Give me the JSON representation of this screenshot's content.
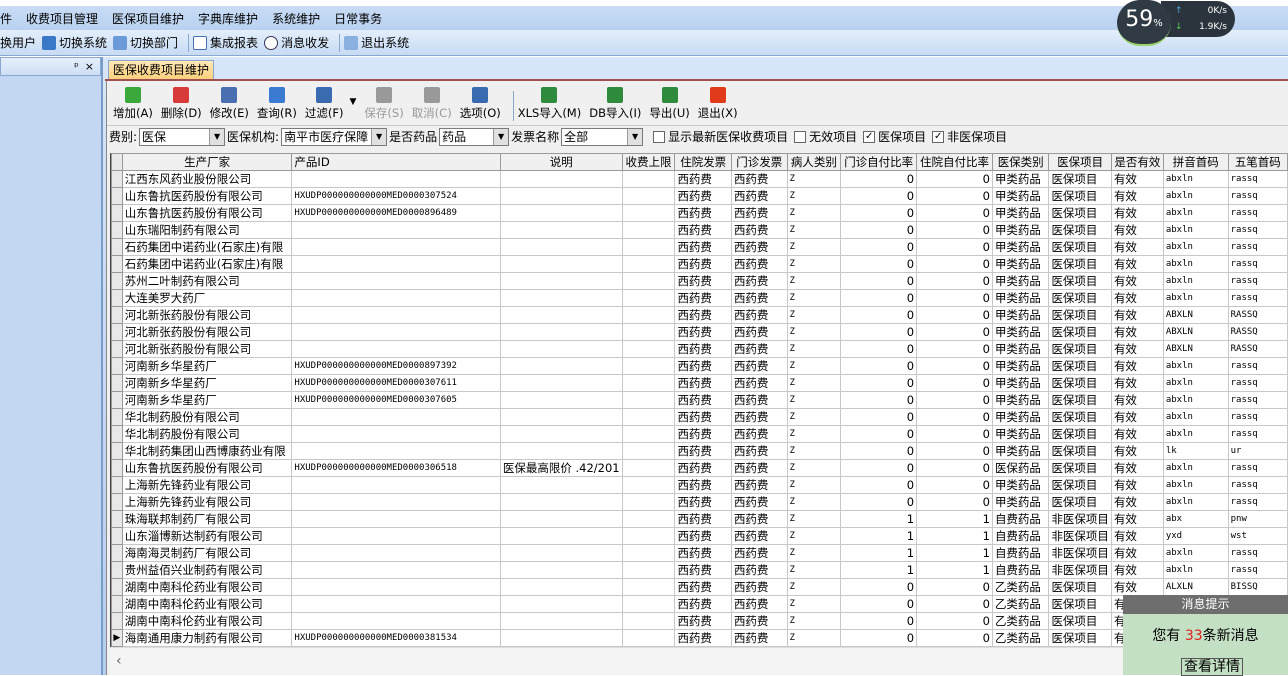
{
  "menu": [
    "收费项目管理",
    "医保项目维护",
    "字典库维护",
    "系统维护",
    "日常事务"
  ],
  "menu_prefix": "件",
  "toolbar": {
    "items": [
      "换用户",
      "切换系统",
      "切换部门",
      "集成报表",
      "消息收发",
      "退出系统"
    ]
  },
  "left_pane": {
    "pin": "ᵖ",
    "close": "×"
  },
  "tab": "医保收费项目维护",
  "actions": [
    {
      "label": "增加(A)",
      "color": "#3aa83a"
    },
    {
      "label": "删除(D)",
      "color": "#d83a3a"
    },
    {
      "label": "修改(E)",
      "color": "#4a6fb0"
    },
    {
      "label": "查询(R)",
      "color": "#3a7ad0"
    },
    {
      "label": "过滤(F)",
      "color": "#3a6ab0"
    },
    {
      "label": "保存(S)",
      "color": "#999999",
      "disabled": true
    },
    {
      "label": "取消(C)",
      "color": "#999999",
      "disabled": true
    },
    {
      "label": "选项(O)",
      "color": "#3a6ab0"
    },
    {
      "label": "XLS导入(M)",
      "color": "#2e8b3e"
    },
    {
      "label": "DB导入(I)",
      "color": "#2e8b3e"
    },
    {
      "label": "导出(U)",
      "color": "#2e8b3e"
    },
    {
      "label": "退出(X)",
      "color": "#e03a1a"
    }
  ],
  "filters": {
    "fee_type_label": "费别:",
    "fee_type": "医保",
    "agency_label": "医保机构:",
    "agency": "南平市医疗保障",
    "is_drug_label": "是否药品",
    "is_drug": "药品",
    "invoice_label": "发票名称",
    "invoice": "全部",
    "checks": [
      {
        "label": "显示最新医保收费项目",
        "checked": false
      },
      {
        "label": "无效项目",
        "checked": false
      },
      {
        "label": "医保项目",
        "checked": true
      },
      {
        "label": "非医保项目",
        "checked": true
      }
    ]
  },
  "columns": [
    "生产厂家",
    "产品ID",
    "说明",
    "收费上限",
    "住院发票",
    "门诊发票",
    "病人类别",
    "门诊自付比率",
    "住院自付比率",
    "医保类别",
    "医保项目",
    "是否有效",
    "拼音首码",
    "五笔首码"
  ],
  "rows": [
    [
      "江西东风药业股份限公司",
      "",
      "",
      "",
      "西药费",
      "西药费",
      "Z",
      "0",
      "0",
      "甲类药品",
      "医保项目",
      "有效",
      "abxln",
      "rassq"
    ],
    [
      "山东鲁抗医药股份有限公司",
      "HXUDP000000000000MED0000307524",
      "",
      "",
      "西药费",
      "西药费",
      "Z",
      "0",
      "0",
      "甲类药品",
      "医保项目",
      "有效",
      "abxln",
      "rassq"
    ],
    [
      "山东鲁抗医药股份有限公司",
      "HXUDP000000000000MED0000896489",
      "",
      "",
      "西药费",
      "西药费",
      "Z",
      "0",
      "0",
      "甲类药品",
      "医保项目",
      "有效",
      "abxln",
      "rassq"
    ],
    [
      "山东瑞阳制药有限公司",
      "",
      "",
      "",
      "西药费",
      "西药费",
      "Z",
      "0",
      "0",
      "甲类药品",
      "医保项目",
      "有效",
      "abxln",
      "rassq"
    ],
    [
      "石药集团中诺药业(石家庄)有限",
      "",
      "",
      "",
      "西药费",
      "西药费",
      "Z",
      "0",
      "0",
      "甲类药品",
      "医保项目",
      "有效",
      "abxln",
      "rassq"
    ],
    [
      "石药集团中诺药业(石家庄)有限",
      "",
      "",
      "",
      "西药费",
      "西药费",
      "Z",
      "0",
      "0",
      "甲类药品",
      "医保项目",
      "有效",
      "abxln",
      "rassq"
    ],
    [
      "苏州二叶制药有限公司",
      "",
      "",
      "",
      "西药费",
      "西药费",
      "Z",
      "0",
      "0",
      "甲类药品",
      "医保项目",
      "有效",
      "abxln",
      "rassq"
    ],
    [
      "大连美罗大药厂",
      "",
      "",
      "",
      "西药费",
      "西药费",
      "Z",
      "0",
      "0",
      "甲类药品",
      "医保项目",
      "有效",
      "abxln",
      "rassq"
    ],
    [
      "河北新张药股份有限公司",
      "",
      "",
      "",
      "西药费",
      "西药费",
      "Z",
      "0",
      "0",
      "甲类药品",
      "医保项目",
      "有效",
      "ABXLN",
      "RASSQ"
    ],
    [
      "河北新张药股份有限公司",
      "",
      "",
      "",
      "西药费",
      "西药费",
      "Z",
      "0",
      "0",
      "甲类药品",
      "医保项目",
      "有效",
      "ABXLN",
      "RASSQ"
    ],
    [
      "河北新张药股份有限公司",
      "",
      "",
      "",
      "西药费",
      "西药费",
      "Z",
      "0",
      "0",
      "甲类药品",
      "医保项目",
      "有效",
      "ABXLN",
      "RASSQ"
    ],
    [
      "河南新乡华星药厂",
      "HXUDP000000000000MED0000897392",
      "",
      "",
      "西药费",
      "西药费",
      "Z",
      "0",
      "0",
      "甲类药品",
      "医保项目",
      "有效",
      "abxln",
      "rassq"
    ],
    [
      "河南新乡华星药厂",
      "HXUDP000000000000MED0000307611",
      "",
      "",
      "西药费",
      "西药费",
      "Z",
      "0",
      "0",
      "甲类药品",
      "医保项目",
      "有效",
      "abxln",
      "rassq"
    ],
    [
      "河南新乡华星药厂",
      "HXUDP000000000000MED0000307605",
      "",
      "",
      "西药费",
      "西药费",
      "Z",
      "0",
      "0",
      "甲类药品",
      "医保项目",
      "有效",
      "abxln",
      "rassq"
    ],
    [
      "华北制药股份有限公司",
      "",
      "",
      "",
      "西药费",
      "西药费",
      "Z",
      "0",
      "0",
      "甲类药品",
      "医保项目",
      "有效",
      "abxln",
      "rassq"
    ],
    [
      "华北制药股份有限公司",
      "",
      "",
      "",
      "西药费",
      "西药费",
      "Z",
      "0",
      "0",
      "甲类药品",
      "医保项目",
      "有效",
      "abxln",
      "rassq"
    ],
    [
      "华北制药集团山西博康药业有限",
      "",
      "",
      "",
      "西药费",
      "西药费",
      "Z",
      "0",
      "0",
      "甲类药品",
      "医保项目",
      "有效",
      "lk",
      "ur"
    ],
    [
      "山东鲁抗医药股份有限公司",
      "HXUDP000000000000MED0000306518",
      "医保最高限价 .42/201",
      "",
      "西药费",
      "西药费",
      "Z",
      "0",
      "0",
      "医保药品",
      "医保项目",
      "有效",
      "abxln",
      "rassq"
    ],
    [
      "上海新先锋药业有限公司",
      "",
      "",
      "",
      "西药费",
      "西药费",
      "Z",
      "0",
      "0",
      "甲类药品",
      "医保项目",
      "有效",
      "abxln",
      "rassq"
    ],
    [
      "上海新先锋药业有限公司",
      "",
      "",
      "",
      "西药费",
      "西药费",
      "Z",
      "0",
      "0",
      "甲类药品",
      "医保项目",
      "有效",
      "abxln",
      "rassq"
    ],
    [
      "珠海联邦制药厂有限公司",
      "",
      "",
      "",
      "西药费",
      "西药费",
      "Z",
      "1",
      "1",
      "自费药品",
      "非医保项目",
      "有效",
      "abx",
      "pnw"
    ],
    [
      "山东淄博新达制药有限公司",
      "",
      "",
      "",
      "西药费",
      "西药费",
      "Z",
      "1",
      "1",
      "自费药品",
      "非医保项目",
      "有效",
      "yxd",
      "wst"
    ],
    [
      "海南海灵制药厂有限公司",
      "",
      "",
      "",
      "西药费",
      "西药费",
      "Z",
      "1",
      "1",
      "自费药品",
      "非医保项目",
      "有效",
      "abxln",
      "rassq"
    ],
    [
      "贵州益佰兴业制药有限公司",
      "",
      "",
      "",
      "西药费",
      "西药费",
      "Z",
      "1",
      "1",
      "自费药品",
      "非医保项目",
      "有效",
      "abxln",
      "rassq"
    ],
    [
      "湖南中南科伦药业有限公司",
      "",
      "",
      "",
      "西药费",
      "西药费",
      "Z",
      "0",
      "0",
      "乙类药品",
      "医保项目",
      "有效",
      "ALXLN",
      "BISSQ"
    ],
    [
      "湖南中南科伦药业有限公司",
      "",
      "",
      "",
      "西药费",
      "西药费",
      "Z",
      "0",
      "0",
      "乙类药品",
      "医保项目",
      "有",
      "",
      ""
    ],
    [
      "湖南中南科伦药业有限公司",
      "",
      "",
      "",
      "西药费",
      "西药费",
      "Z",
      "0",
      "0",
      "乙类药品",
      "医保项目",
      "有",
      "",
      ""
    ],
    [
      "海南通用康力制药有限公司",
      "HXUDP000000000000MED0000381534",
      "",
      "",
      "西药费",
      "西药费",
      "Z",
      "0",
      "0",
      "乙类药品",
      "医保项目",
      "有",
      "",
      ""
    ]
  ],
  "current_row": 27,
  "network": {
    "cpu": "59",
    "cpu_unit": "%",
    "up": "0K/s",
    "down": "1.9K/s"
  },
  "message": {
    "title": "消息提示",
    "prefix": "您有",
    "count": "33",
    "suffix": "条新消息",
    "button": "查看详情"
  }
}
